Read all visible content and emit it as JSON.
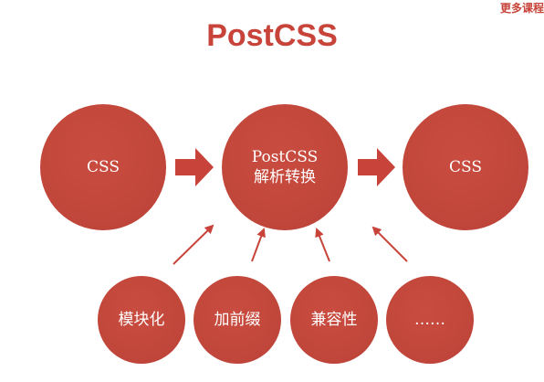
{
  "corner_label": "更多课程",
  "title": "PostCSS",
  "nodes": {
    "input": "CSS",
    "process_line1": "PostCSS",
    "process_line2": "解析转换",
    "output": "CSS"
  },
  "plugins": [
    "模块化",
    "加前缀",
    "兼容性",
    "……"
  ],
  "colors": {
    "accent": "#c8443a",
    "circle": "#c2473b",
    "arrow": "#c8443a",
    "text_on_circle": "#ffffff"
  }
}
